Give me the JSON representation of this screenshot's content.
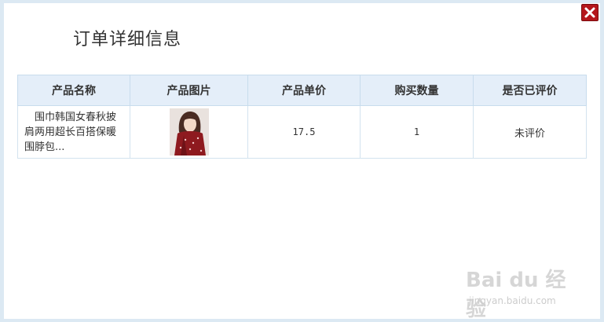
{
  "dialog": {
    "title": "订单详细信息",
    "close_icon": "close-icon"
  },
  "table": {
    "headers": [
      "产品名称",
      "产品图片",
      "产品单价",
      "购买数量",
      "是否已评价"
    ],
    "rows": [
      {
        "name": "围巾韩国女春秋披肩两用超长百搭保暖围脖包...",
        "image_icon": "product-thumbnail-scarf",
        "price": "17.5",
        "quantity": "1",
        "review_status": "未评价"
      }
    ]
  },
  "watermark": {
    "logo": "Bai du 经验",
    "url": "jingyan.baidu.com"
  },
  "colors": {
    "header_bg": "#e4eef9",
    "border": "#c8dced",
    "close_bg": "#b5161b",
    "frame_bg": "#dce9f3"
  }
}
